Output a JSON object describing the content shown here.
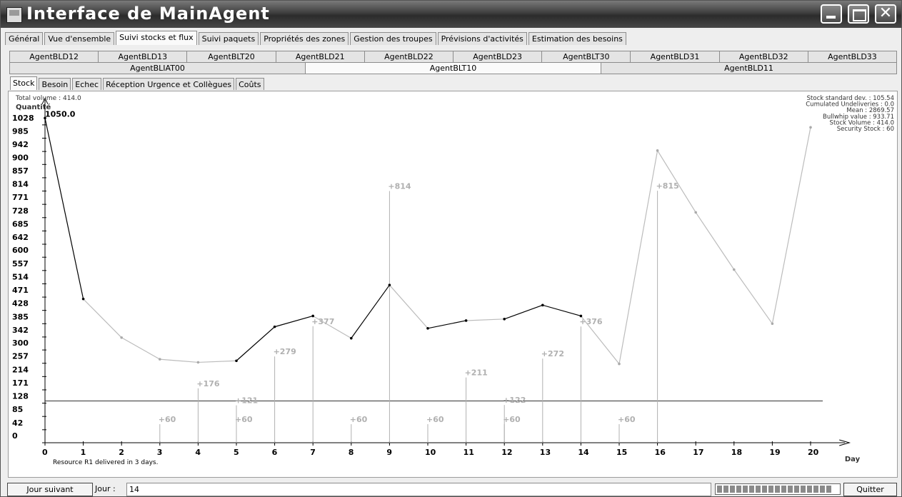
{
  "window": {
    "title": "Interface de MainAgent",
    "close_glyph": "✕"
  },
  "main_tabs": [
    "Général",
    "Vue d'ensemble",
    "Suivi stocks et flux",
    "Suivi paquets",
    "Propriétés des zones",
    "Gestion des troupes",
    "Prévisions d'activités",
    "Estimation des besoins"
  ],
  "main_tabs_active": 2,
  "agent_tabs_row1": [
    "AgentBLD12",
    "AgentBLD13",
    "AgentBLT20",
    "AgentBLD21",
    "AgentBLD22",
    "AgentBLD23",
    "AgentBLT30",
    "AgentBLD31",
    "AgentBLD32",
    "AgentBLD33"
  ],
  "agent_tabs_row2": [
    "AgentBLIAT00",
    "AgentBLT10",
    "AgentBLD11"
  ],
  "agent_tabs_active": "AgentBLT10",
  "sub_tabs": [
    "Stock",
    "Besoin",
    "Echec",
    "Réception Urgence et Collègues",
    "Coûts"
  ],
  "sub_tabs_active": 0,
  "chart_data": {
    "type": "line",
    "total_volume_label": "Total volume : 414.0",
    "ylabel": "Quantité",
    "xlabel": "Day",
    "yticks": [
      0,
      42,
      85,
      128,
      171,
      214,
      257,
      300,
      342,
      385,
      428,
      471,
      514,
      557,
      600,
      642,
      685,
      728,
      771,
      814,
      857,
      900,
      942,
      985,
      1028
    ],
    "ylim": [
      0,
      1100
    ],
    "x": [
      0,
      1,
      2,
      3,
      4,
      5,
      6,
      7,
      8,
      9,
      10,
      11,
      12,
      13,
      14,
      15,
      16,
      17,
      18,
      19,
      20
    ],
    "series": [
      {
        "values": [
          1050,
          465,
          340,
          270,
          260,
          265,
          375,
          410,
          338,
          510,
          370,
          395,
          400,
          445,
          410,
          255,
          945,
          745,
          560,
          385,
          1020
        ]
      }
    ],
    "black_segments_start_day": [
      0,
      5,
      6,
      8,
      10,
      12,
      13
    ],
    "start_label": "1050.0",
    "deliveries": [
      {
        "day": 3,
        "amount": 60,
        "label": "+60"
      },
      {
        "day": 4,
        "amount": 176,
        "label": "+176"
      },
      {
        "day": 5,
        "amount": 60,
        "label": "+60"
      },
      {
        "day": 5,
        "amount": 121,
        "label": "+121"
      },
      {
        "day": 6,
        "amount": 279,
        "label": "+279"
      },
      {
        "day": 7,
        "amount": 377,
        "label": "+377"
      },
      {
        "day": 8,
        "amount": 60,
        "label": "+60"
      },
      {
        "day": 9,
        "amount": 814,
        "label": "+814"
      },
      {
        "day": 10,
        "amount": 60,
        "label": "+60"
      },
      {
        "day": 11,
        "amount": 211,
        "label": "+211"
      },
      {
        "day": 12,
        "amount": 60,
        "label": "+60"
      },
      {
        "day": 12,
        "amount": 122,
        "label": "+122"
      },
      {
        "day": 13,
        "amount": 272,
        "label": "+272"
      },
      {
        "day": 14,
        "amount": 376,
        "label": "+376"
      },
      {
        "day": 15,
        "amount": 60,
        "label": "+60"
      },
      {
        "day": 16,
        "amount": 815,
        "label": "+815"
      }
    ],
    "security_stock": 135,
    "stats": [
      "Stock standard dev. : 105.54",
      "Cumulated Undeliveries : 0.0",
      "Mean : 2869.57",
      "Bullwhip value : 933.71",
      "Stock Volume : 414.0",
      "Security Stock : 60"
    ],
    "note": "Resource R1 delivered in 3 days.",
    "colors": {
      "stock_line": "#bcbcbc",
      "stock_line_dark": "#000000",
      "delivery": "#b0b0b0"
    }
  },
  "bottom": {
    "next_button": "Jour suivant",
    "jour_label": "Jour :",
    "jour_value": "14",
    "progress": 0.95,
    "quit_button": "Quitter"
  }
}
